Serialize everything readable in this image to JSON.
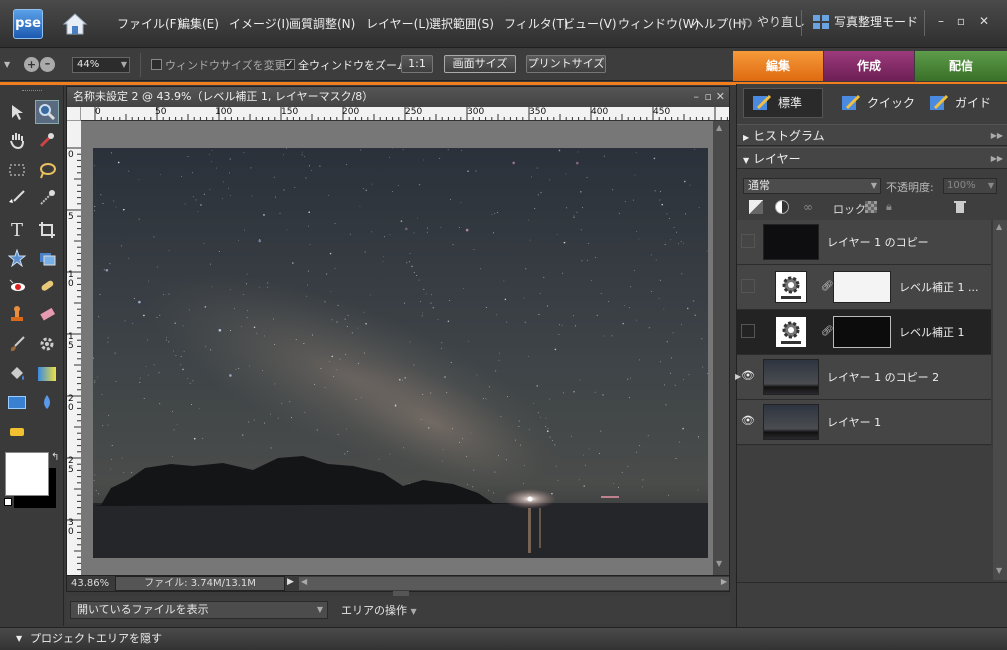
{
  "app": {
    "logo": "pse",
    "menus": [
      "ファイル(F)",
      "編集(E)",
      "イメージ(I)",
      "画質調整(N)",
      "レイヤー(L)",
      "選択範囲(S)",
      "フィルタ(T)",
      "ビュー(V)",
      "ウィンドウ(W)",
      "ヘルプ(H)"
    ],
    "undo_label": "やり直し",
    "organizer_label": "写真整理モード",
    "window_controls": [
      "minimize",
      "maximize",
      "close"
    ]
  },
  "options": {
    "zoom_value": "44%",
    "resize_window_label": "ウィンドウサイズを変更",
    "resize_window_checked": false,
    "zoom_all_label": "全ウィンドウをズーム",
    "zoom_all_checked": true,
    "btn_actual": "1:1",
    "btn_screen": "画面サイズ",
    "btn_print": "プリントサイズ"
  },
  "modes": [
    {
      "label": "編集",
      "color": "#f07d1e"
    },
    {
      "label": "作成",
      "color": "#8a2a6a"
    },
    {
      "label": "配信",
      "color": "#4a8a3a"
    }
  ],
  "edit_panel": {
    "tabs": [
      {
        "label": "標準",
        "icon": "pencil-standard-icon"
      },
      {
        "label": "クイック",
        "icon": "pencil-quick-icon"
      },
      {
        "label": "ガイド",
        "icon": "pencil-guide-icon"
      }
    ]
  },
  "sections": {
    "histogram": "ヒストグラム",
    "layers": "レイヤー"
  },
  "layers_panel": {
    "blend_mode": "通常",
    "opacity_label": "不透明度:",
    "opacity_value": "100%",
    "lock_label": "ロック:",
    "layers": [
      {
        "name": "レイヤー 1 のコピー",
        "visible": false,
        "type": "dark",
        "indent": false,
        "selected": false
      },
      {
        "name": "レベル補正 1 ...",
        "visible": false,
        "type": "adjust-white",
        "indent": true,
        "selected": false
      },
      {
        "name": "レベル補正 1",
        "visible": false,
        "type": "adjust-dark",
        "indent": true,
        "selected": true
      },
      {
        "name": "レイヤー 1 のコピー 2",
        "visible": true,
        "type": "photo",
        "indent": false,
        "selected": false
      },
      {
        "name": "レイヤー 1",
        "visible": true,
        "type": "photo",
        "indent": false,
        "selected": false
      }
    ]
  },
  "document": {
    "title": "名称未設定 2 @ 43.9%（レベル補正 1, レイヤーマスク/8）",
    "zoom_status": "43.86%",
    "file_status": "ファイル: 3.74M/13.1M",
    "ruler_top": [
      "0",
      "50",
      "100",
      "150",
      "200",
      "250",
      "300",
      "350",
      "400",
      "450"
    ],
    "ruler_left": [
      "0",
      "5",
      "1 0",
      "1 5",
      "2 0",
      "2 5",
      "3 0"
    ]
  },
  "bottom": {
    "show_files": "開いているファイルを表示",
    "area_ops": "エリアの操作"
  },
  "project": {
    "hide_label": "プロジェクトエリアを隠す"
  }
}
